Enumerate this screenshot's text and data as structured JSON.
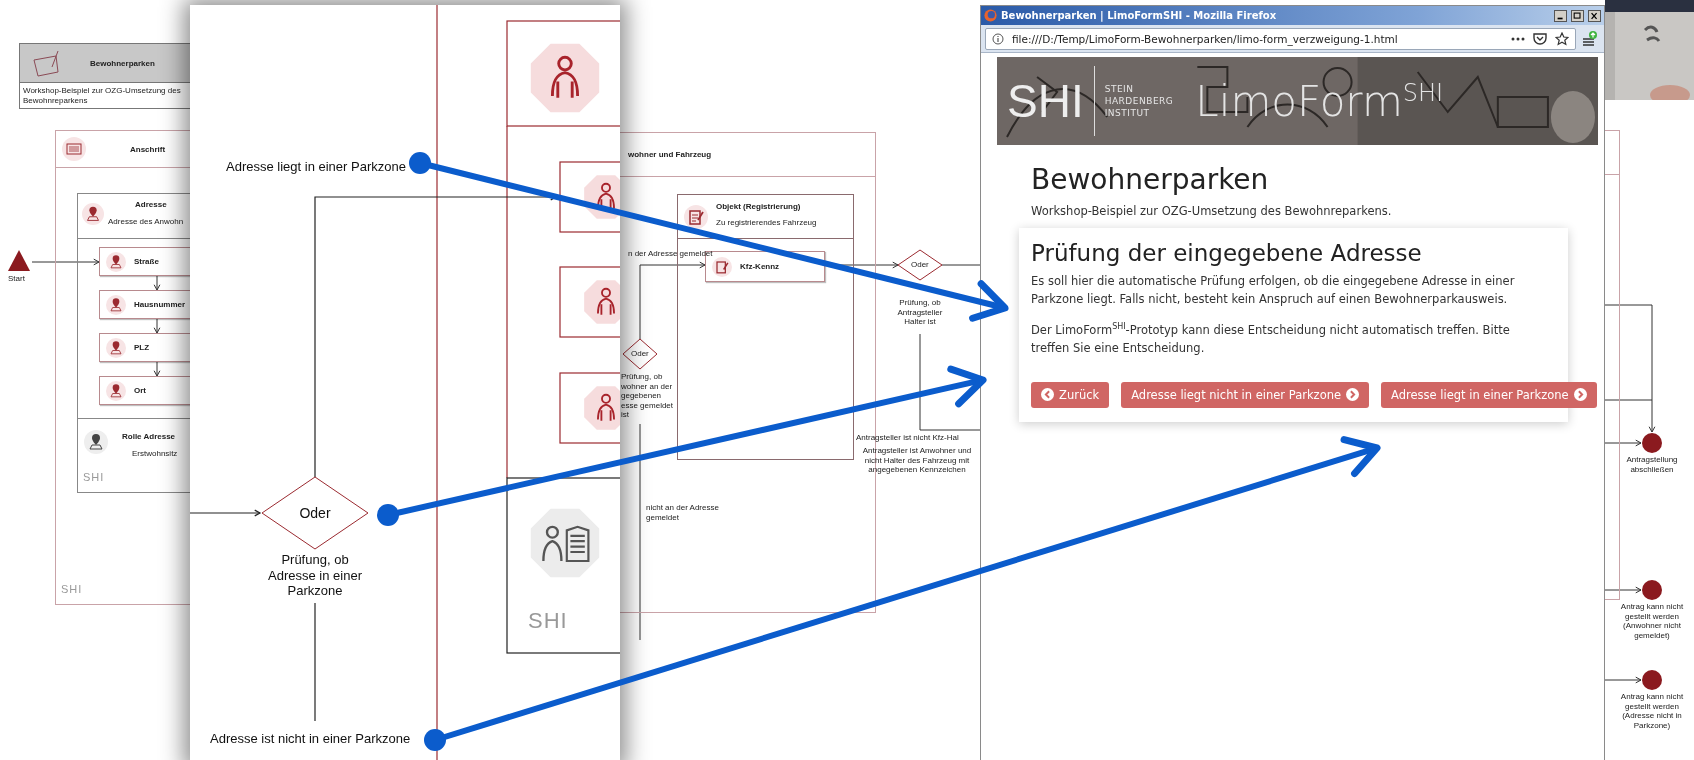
{
  "overview_diagram": {
    "header": {
      "title": "Bewohnerparken",
      "subtitle": "Workshop-Beispiel zur OZG-Umsetzung des Bewohnreparkens"
    },
    "start": {
      "label": "Start"
    },
    "anschrift": {
      "title": "Anschrift",
      "adresse": {
        "title": "Adresse",
        "subtitle": "Adresse des Anwohn"
      },
      "fields": [
        "Straße",
        "Hausnummer",
        "PLZ",
        "Ort"
      ],
      "rolle": {
        "title": "Rolle Adresse",
        "subtitle": "Erstwohnsitz"
      },
      "logos": [
        "SHI",
        "SHI"
      ]
    },
    "fahrzeug": {
      "title": "wohner und Fahrzeug",
      "objekt": {
        "title": "Objekt (Registrierung)",
        "subtitle": "Zu registrierendes Fahrzeug"
      },
      "field": "Kfz-Kennz",
      "edge_labels": [
        "n der Adresse gemeldet",
        "nicht an der Adresse gemeldet"
      ],
      "gateway": {
        "label": "Oder",
        "caption": "Prüfung, ob wohner an der gegebenen esse gemeldet ist"
      }
    },
    "halter_check": {
      "gateway": {
        "label": "Oder",
        "caption": "Prüfung, ob Antragsteller Halter ist"
      },
      "edge_labels": [
        "Antragsteller ist nicht Kfz-Hal",
        "Antragsteller ist Anwohner und nicht Halter des Fahrzeug mit angegebenen Kennzeichen"
      ]
    },
    "end_events": [
      {
        "label": "Antragstellung abschließen"
      },
      {
        "label": "Antrag kann nicht gestellt werden (Anwohner nicht gemeldet)"
      },
      {
        "label": "Antrag kann nicht gestellt werden (Adresse nicht in Parkzone)"
      }
    ]
  },
  "zoomed_diagram": {
    "branch_labels": [
      "Adresse liegt in einer Parkzone",
      "Adresse ist nicht in einer Parkzone"
    ],
    "gateway": {
      "label": "Oder",
      "caption": "Prüfung, ob Adresse in einer Parkzone"
    },
    "logo": "SHI"
  },
  "browser": {
    "title": "Bewohnerparken | LimoFormSHI - Mozilla Firefox",
    "url": "file:///D:/Temp/LimoForm-Bewohnerparken/limo-form_verzweigung-1.html",
    "banner": {
      "logo": "SHI",
      "institute": [
        "STEIN",
        "HARDENBERG",
        "INSTITUT"
      ],
      "product": "LimoForm$^{SHI}$"
    },
    "page": {
      "title": "Bewohnerparken",
      "subtitle": "Workshop-Beispiel zur OZG-Umsetzung des Bewohnreparkens."
    },
    "card": {
      "title": "Prüfung der eingegebene Adresse",
      "paragraphs": [
        "Es soll hier die automatische Prüfung erfolgen, ob die eingegebene Adresse in einer Parkzone liegt. Falls nicht, besteht kein Anspruch auf einen Bewohnerparkausweis.",
        "Der LimoForm$^{SHI}$-Prototyp kann diese Entscheidung nicht automatisch treffen. Bitte treffen Sie eine Entscheidung."
      ],
      "buttons": [
        {
          "label": "Zurück",
          "kind": "back"
        },
        {
          "label": "Adresse liegt nicht in einer Parkzone",
          "kind": "next"
        },
        {
          "label": "Adresse liegt in einer Parkzone",
          "kind": "next"
        }
      ]
    }
  }
}
